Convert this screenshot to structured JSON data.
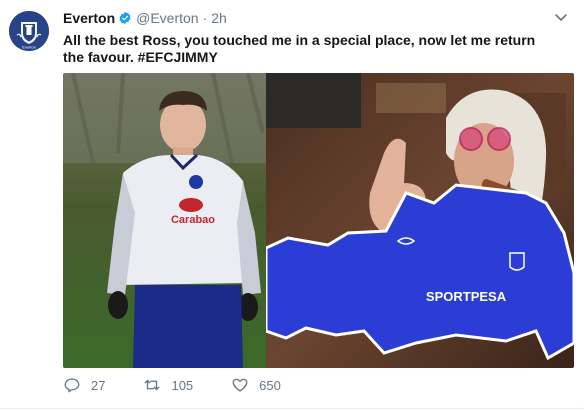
{
  "account": {
    "display_name": "Everton",
    "handle": "@Everton",
    "separator": "·",
    "time": "2h",
    "avatar_text": "Everton"
  },
  "tweet": {
    "text": "All the best Ross, you touched me in a special place, now let me return the favour. #EFCJIMMY"
  },
  "media": {
    "right_kit_sponsor": "SPORTPESA",
    "left_kit_sponsor": "Carabao"
  },
  "actions": {
    "replies": "27",
    "retweets": "105",
    "likes": "650"
  },
  "colors": {
    "everton_blue": "#274488",
    "kit_blue": "#2c3dd6",
    "verified_blue": "#1da1f2",
    "muted_text": "#657786"
  }
}
